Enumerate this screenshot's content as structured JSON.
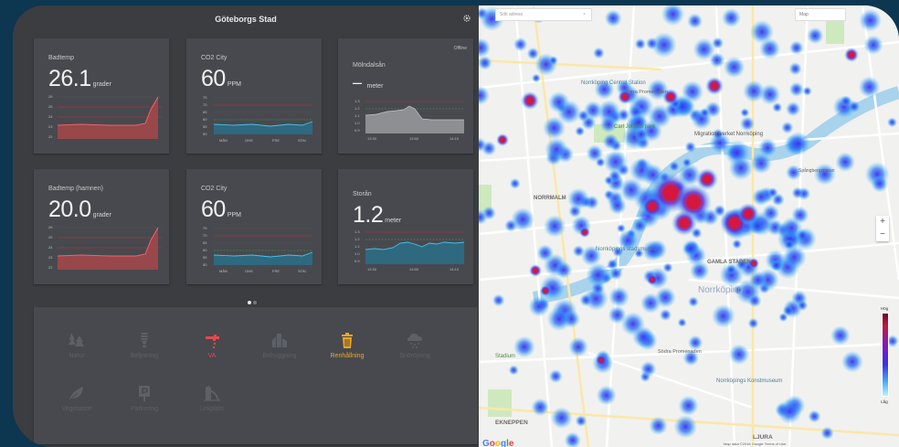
{
  "header": {
    "title": "Göteborgs Stad"
  },
  "cards": [
    {
      "title": "Badtemp",
      "value": "26.1",
      "unit": "grader",
      "status": "",
      "y_ticks": [
        "26",
        "25",
        "24",
        "23",
        "22"
      ],
      "x_ticks": [],
      "color": "#e45b5d"
    },
    {
      "title": "CO2 City",
      "value": "60",
      "unit": "PPM",
      "status": "",
      "y_ticks": [
        "75",
        "70",
        "65",
        "60",
        "55",
        "50"
      ],
      "x_ticks": [
        "MÅN",
        "ONS",
        "FRE",
        "SÖN"
      ],
      "color": "#3aa0c9"
    },
    {
      "title": "Mölndalsån",
      "value": "–",
      "unit": "meter",
      "status": "Offline",
      "y_ticks": [
        "1.3",
        "1.2",
        "1.1",
        "1.0",
        "0.9"
      ],
      "x_ticks": [
        "13:30",
        "13:50",
        "14:10"
      ],
      "color": "#9c9c9c"
    },
    {
      "title": "Badtemp (hamnen)",
      "value": "20.0",
      "unit": "grader",
      "status": "",
      "y_ticks": [
        "26",
        "25",
        "24",
        "23",
        "22"
      ],
      "x_ticks": [],
      "color": "#e45b5d"
    },
    {
      "title": "CO2 City",
      "value": "60",
      "unit": "PPM",
      "status": "",
      "y_ticks": [
        "75",
        "70",
        "65",
        "60",
        "55",
        "50"
      ],
      "x_ticks": [
        "MÅN",
        "ONS",
        "FRE",
        "SÖN"
      ],
      "color": "#3aa0c9"
    },
    {
      "title": "Storån",
      "value": "1.2",
      "unit": "meter",
      "status": "",
      "y_ticks": [
        "1.3",
        "1.2",
        "1.1",
        "1.0",
        "0.9"
      ],
      "x_ticks": [
        "13:30",
        "13:50",
        "14:10"
      ],
      "color": "#3aa0c9"
    }
  ],
  "categories": [
    {
      "label": "Natur",
      "icon": "trees-icon",
      "state": "inactive"
    },
    {
      "label": "Belysning",
      "icon": "bulb-icon",
      "state": "inactive"
    },
    {
      "label": "VA",
      "icon": "faucet-icon",
      "state": "active-red"
    },
    {
      "label": "Bebyggning",
      "icon": "buildings-icon",
      "state": "inactive"
    },
    {
      "label": "Renhållning",
      "icon": "trash-icon",
      "state": "active-yellow"
    },
    {
      "label": "Snöröjning",
      "icon": "snow-cloud-icon",
      "state": "inactive"
    },
    {
      "label": "Vegetation",
      "icon": "leaf-icon",
      "state": "inactive"
    },
    {
      "label": "Parkering",
      "icon": "parking-icon",
      "state": "inactive"
    },
    {
      "label": "Lekplats",
      "icon": "playground-icon",
      "state": "inactive"
    }
  ],
  "pagination": {
    "current": 1,
    "total": 2
  },
  "map": {
    "search_placeholder": "Sök adress",
    "type_label": "Map",
    "labels": [
      "Norrköping Central Station",
      "Carl Johans park",
      "Migrationsverket Norrköping",
      "NORRMALM",
      "Norrköpings stadsmuseum",
      "Norrköping",
      "GAMLA STADEN",
      "Norra Promenaden",
      "Södra Promenaden",
      "Norrköpings Konstmuseum",
      "Stadium",
      "Spångbergsgatan",
      "EKNEPPEN",
      "LJURA"
    ],
    "zoom_in": "+",
    "zoom_out": "−",
    "legend_high": "Hög",
    "legend_low": "Låg",
    "attribution": "Map data ©2018 Google   Terms of Use",
    "logo": "Google",
    "colors": {
      "water": "#a9d3ec",
      "park": "#cfe9bf",
      "heat_low": "#2fb3ff",
      "heat_high": "#e0123f"
    }
  }
}
